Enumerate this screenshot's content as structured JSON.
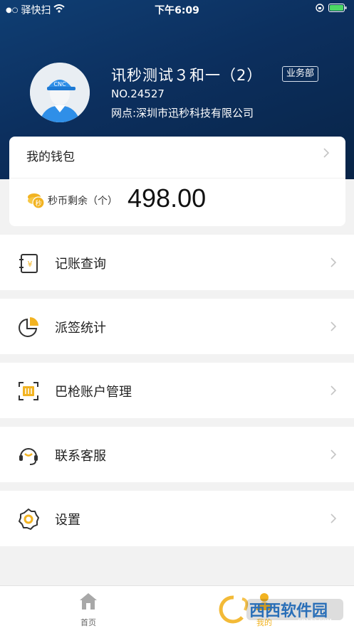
{
  "status_bar": {
    "carrier": "驿快扫",
    "time": "下午6:09"
  },
  "profile": {
    "name": "讯秒测试３和一（2）",
    "badge": "业务部",
    "number": "NO.24527",
    "site": "网点:深圳市迅秒科技有限公司",
    "avatar_cap_text": "CNC"
  },
  "wallet": {
    "title": "我的钱包",
    "coin_label": "秒币剩余（个）",
    "coin_value": "498.00",
    "coin_icon_text": "秒"
  },
  "menu": {
    "items": [
      {
        "label": "记账查询",
        "icon": "ledger-icon"
      },
      {
        "label": "派签统计",
        "icon": "pie-chart-icon"
      },
      {
        "label": "巴枪账户管理",
        "icon": "scanner-icon"
      },
      {
        "label": "联系客服",
        "icon": "headset-icon"
      },
      {
        "label": "设置",
        "icon": "gear-icon"
      }
    ]
  },
  "tabbar": {
    "home_label": "首页",
    "mine_label": "我的"
  },
  "watermark": {
    "brand": "西西软件园",
    "url": "CR173.COM"
  },
  "colors": {
    "accent": "#f2b321",
    "header": "#0c2f5e",
    "icon_stroke": "#333333"
  }
}
